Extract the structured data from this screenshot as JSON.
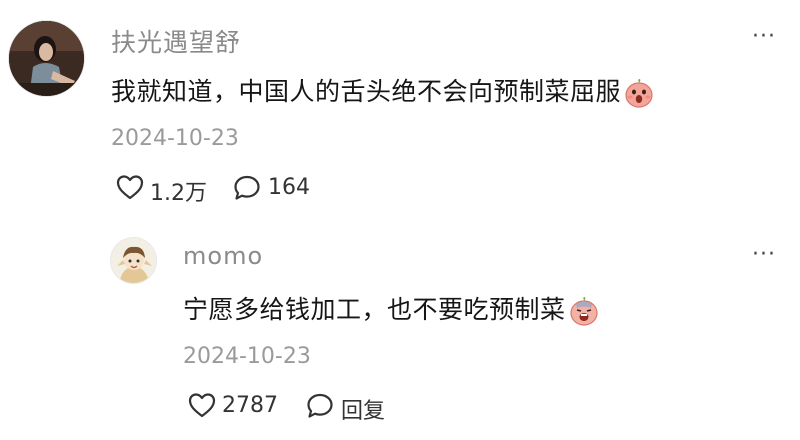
{
  "comment": {
    "username": "扶光遇望舒",
    "text": "我就知道，中国人的舌头绝不会向预制菜屈服",
    "emoji_icon": "shocked-peach-emoji-icon",
    "date": "2024-10-23",
    "likes": "1.2万",
    "comments": "164",
    "more": "···"
  },
  "reply": {
    "username": "momo",
    "text": "宁愿多给钱加工，也不要吃预制菜",
    "emoji_icon": "crying-peach-emoji-icon",
    "date": "2024-10-23",
    "likes": "2787",
    "reply_label": "回复",
    "more": "···"
  },
  "colors": {
    "username": "#8a8a8a",
    "text": "#161616",
    "date": "#9a9a9a",
    "icon": "#333333",
    "emoji_peach": "#f3a59a"
  }
}
